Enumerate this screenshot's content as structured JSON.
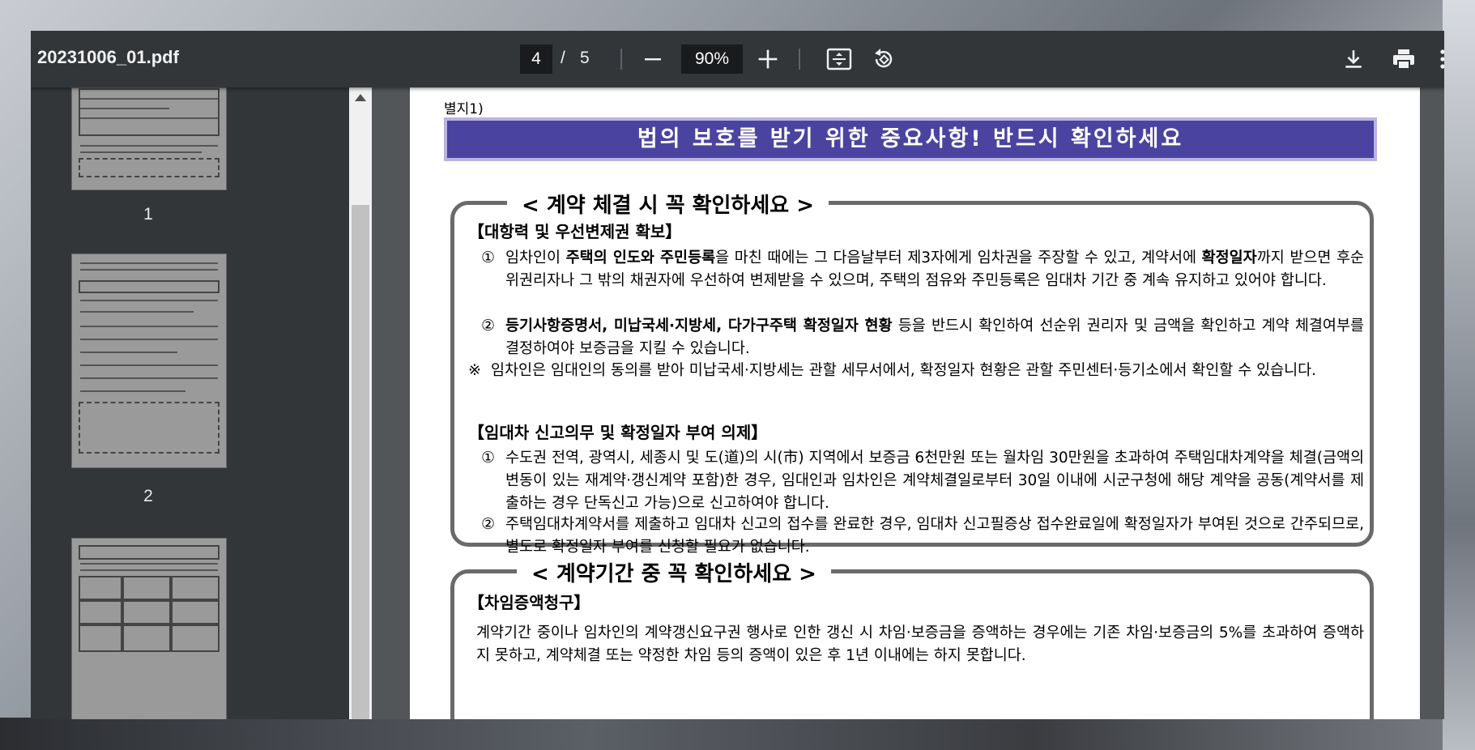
{
  "toolbar": {
    "file_name": "20231006_01.pdf",
    "current_page": "4",
    "page_separator": "/",
    "total_pages": "5",
    "zoom": "90%"
  },
  "thumbnails": [
    {
      "label": "1"
    },
    {
      "label": "2"
    }
  ],
  "document": {
    "byeolji": "별지1)",
    "banner": "법의 보호를 받기 위한 중요사항! 반드시 확인하세요",
    "section1": {
      "title": "< 계약 체결 시 꼭 확인하세요 >",
      "heading1": "【대항력 및 우선변제권 확보】",
      "item1_num": "①",
      "item1_a": "임차인이 ",
      "item1_b": "주택의 인도와 주민등록",
      "item1_c": "을 마친 때에는 그 다음날부터 제3자에게 임차권을 주장할 수 있고, 계약서에 ",
      "item1_d": "확정일자",
      "item1_e": "까지 받으면 후순위권리자나 그 밖의 채권자에 우선하여 변제받을 수 있으며, 주택의 점유와 주민등록은 임대차 기간 중 계속 유지하고 있어야 합니다.",
      "item2_num": "②",
      "item2_b": "등기사항증명서, 미납국세·지방세, 다가구주택 확정일자 현황",
      "item2_c": " 등을 반드시 확인하여 선순위 권리자 및 금액을 확인하고 계약 체결여부를 결정하여야 보증금을 지킬 수 있습니다.",
      "note_mark": "※",
      "note": "임차인은 임대인의 동의를 받아 미납국세·지방세는 관할 세무서에서, 확정일자 현황은 관할 주민센터·등기소에서 확인할 수 있습니다.",
      "heading2": "【임대차 신고의무 및 확정일자 부여 의제】",
      "item3_num": "①",
      "item3": "수도권 전역, 광역시, 세종시 및 도(道)의 시(市) 지역에서 보증금 6천만원 또는 월차임 30만원을 초과하여 주택임대차계약을 체결(금액의 변동이 있는 재계약·갱신계약 포함)한 경우, 임대인과 임차인은 계약체결일로부터 30일 이내에 시군구청에 해당 계약을 공동(계약서를 제출하는 경우 단독신고 가능)으로 신고하여야 합니다.",
      "item4_num": "②",
      "item4": "주택임대차계약서를 제출하고 임대차 신고의 접수를 완료한 경우, 임대차 신고필증상 접수완료일에 확정일자가 부여된 것으로 간주되므로, 별도로 확정일자 부여를 신청할 필요가 없습니다."
    },
    "section2": {
      "title": "< 계약기간 중 꼭 확인하세요 >",
      "heading1": "【차임증액청구】",
      "para1": "계약기간 중이나 임차인의 계약갱신요구권 행사로 인한 갱신 시 차임·보증금을 증액하는 경우에는 기존 차임·보증금의 5%를 초과하여 증액하지 못하고, 계약체결 또는 약정한 차임 등의 증액이 있은 후 1년 이내에는 하지 못합니다."
    }
  },
  "colors": {
    "toolbar_bg": "#323639",
    "viewer_bg": "#525659",
    "banner_bg": "#4a44a0",
    "banner_border": "#b7b3e3"
  }
}
